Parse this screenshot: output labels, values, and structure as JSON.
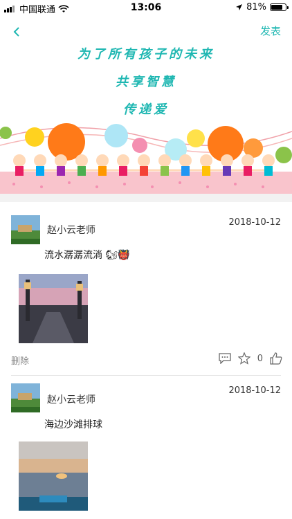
{
  "status": {
    "carrier": "中国联通",
    "time": "13:06",
    "battery": "81%",
    "battery_level": 0.81
  },
  "nav": {
    "publish_label": "发表"
  },
  "header": {
    "slogan_lines": [
      "为了所有孩子的未来",
      "共享智慧",
      "传递爱"
    ]
  },
  "posts": [
    {
      "author": "赵小云老师",
      "date": "2018-10-12",
      "text": "流水潺潺流淌 🐿👹",
      "delete_label": "删除",
      "like_count": "0"
    },
    {
      "author": "赵小云老师",
      "date": "2018-10-12",
      "text": "海边沙滩排球"
    }
  ],
  "icons": {
    "comment": "comment-icon",
    "favorite": "star-icon",
    "like": "thumbs-up-icon",
    "back": "chevron-left-icon"
  },
  "colors": {
    "accent": "#1fb7b2"
  }
}
